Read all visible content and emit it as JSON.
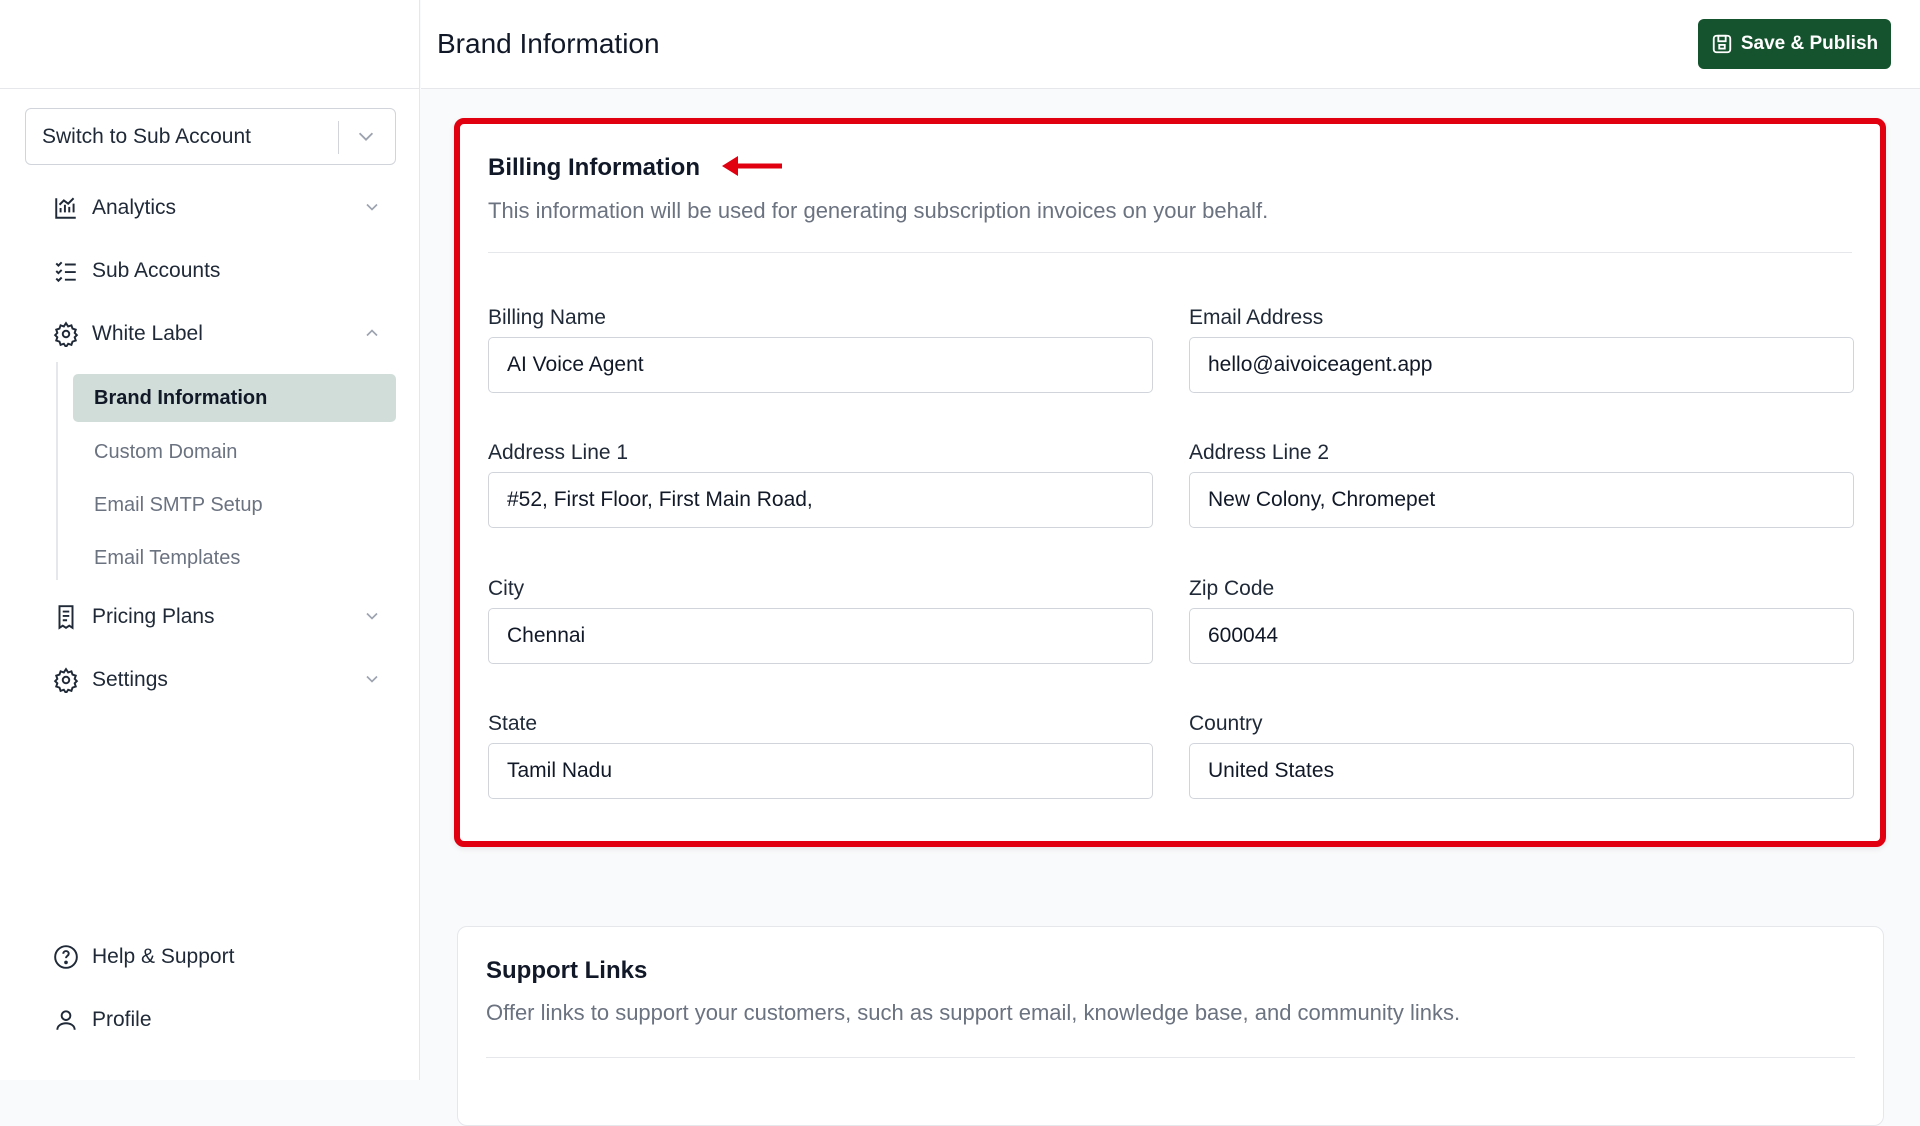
{
  "header": {
    "title": "Brand Information",
    "save_label": "Save & Publish"
  },
  "sidebar": {
    "switcher_label": "Switch to Sub Account",
    "items": [
      {
        "label": "Analytics",
        "icon": "chart-icon"
      },
      {
        "label": "Sub Accounts",
        "icon": "checklist-icon"
      },
      {
        "label": "White Label",
        "icon": "gear-icon"
      },
      {
        "label": "Pricing Plans",
        "icon": "receipt-icon"
      },
      {
        "label": "Settings",
        "icon": "gear-icon"
      }
    ],
    "white_label_sub": [
      "Brand Information",
      "Custom Domain",
      "Email SMTP Setup",
      "Email Templates"
    ],
    "bottom": [
      {
        "label": "Help & Support",
        "icon": "help-icon"
      },
      {
        "label": "Profile",
        "icon": "user-icon"
      }
    ]
  },
  "billing": {
    "title": "Billing Information",
    "subtitle": "This information will be used for generating subscription invoices on your behalf.",
    "fields": [
      {
        "label": "Billing Name",
        "value": "AI Voice Agent"
      },
      {
        "label": "Email Address",
        "value": "hello@aivoiceagent.app"
      },
      {
        "label": "Address Line 1",
        "value": "#52, First Floor, First Main Road,"
      },
      {
        "label": "Address Line 2",
        "value": "New Colony, Chromepet"
      },
      {
        "label": "City",
        "value": "Chennai"
      },
      {
        "label": "Zip Code",
        "value": "600044"
      },
      {
        "label": "State",
        "value": "Tamil Nadu"
      },
      {
        "label": "Country",
        "value": "United States"
      }
    ]
  },
  "support": {
    "title": "Support Links",
    "subtitle": "Offer links to support your customers, such as support email, knowledge base, and community links."
  },
  "colors": {
    "primary": "#14532d",
    "active_bg": "#d1ddd9",
    "highlight": "#e00010"
  }
}
